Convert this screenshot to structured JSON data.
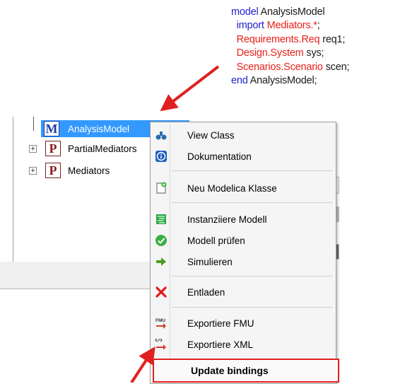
{
  "annotation": {
    "lines": [
      {
        "kw": "model",
        "red": "",
        "rest": " AnalysisModel"
      },
      {
        "kw": "  import",
        "red": " Mediators.*",
        "rest": ";"
      },
      {
        "kw": "",
        "red": "  Requirements.Req",
        "rest": " req1;"
      },
      {
        "kw": "",
        "red": "  Design.System",
        "rest": " sys;"
      },
      {
        "kw": "",
        "red": "  Scenarios.Scenario",
        "rest": " scen;"
      },
      {
        "kw": "end",
        "red": "",
        "rest": " AnalysisModel;"
      }
    ]
  },
  "tree": {
    "items": [
      {
        "label": "AnalysisModel",
        "badge": "M"
      },
      {
        "label": "PartialMediators",
        "badge": "P",
        "expander": "+"
      },
      {
        "label": "Mediators",
        "badge": "P",
        "expander": "+"
      }
    ]
  },
  "menu": {
    "items": [
      {
        "label": "View Class",
        "icon": "view-class-icon"
      },
      {
        "label": "Dokumentation",
        "icon": "info-icon"
      },
      {
        "label": "Neu Modelica Klasse",
        "icon": "new-class-icon"
      },
      {
        "label": "Instanziiere Modell",
        "icon": "instantiate-icon"
      },
      {
        "label": "Modell prüfen",
        "icon": "check-icon"
      },
      {
        "label": "Simulieren",
        "icon": "simulate-arrow-icon"
      },
      {
        "label": "Entladen",
        "icon": "unload-x-icon"
      },
      {
        "label": "Exportiere FMU",
        "icon": "export-fmu-icon"
      },
      {
        "label": "Exportiere XML",
        "icon": "export-xml-icon"
      }
    ],
    "highlighted": "Update bindings",
    "fmu_tag": "FMU"
  },
  "colors": {
    "keyword": "#1f1fcc",
    "string": "#e8201a",
    "selection": "#3399ff",
    "arrow": "#e02020"
  }
}
